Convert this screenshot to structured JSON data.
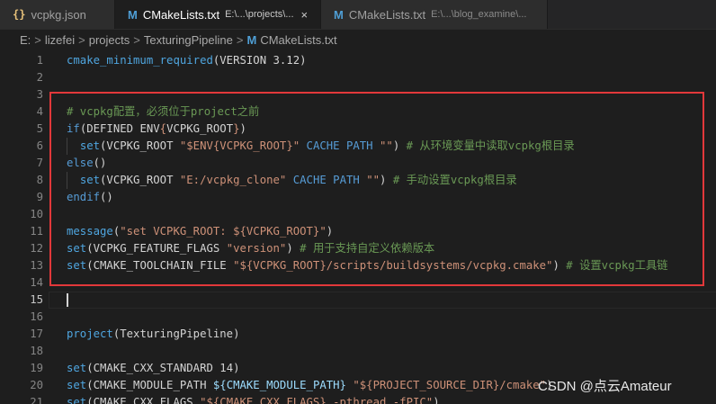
{
  "tabs": [
    {
      "icon": "{}",
      "label": "vcpkg.json",
      "description": "",
      "close": ""
    },
    {
      "icon": "M",
      "label": "CMakeLists.txt",
      "description": "E:\\...\\projects\\...",
      "close": "×"
    },
    {
      "icon": "M",
      "label": "CMakeLists.txt",
      "description": "E:\\...\\blog_examine\\...",
      "close": ""
    }
  ],
  "breadcrumb": {
    "items": [
      "E:",
      "lizefei",
      "projects",
      "TexturingPipeline"
    ],
    "separator": ">",
    "file_icon": "M",
    "file": "CMakeLists.txt"
  },
  "editor": {
    "lines": [
      {
        "n": "1",
        "segs": [
          [
            "fn",
            "cmake_minimum_required"
          ],
          [
            "p",
            "(VERSION 3.12)"
          ]
        ]
      },
      {
        "n": "2",
        "segs": []
      },
      {
        "n": "3",
        "segs": []
      },
      {
        "n": "4",
        "segs": [
          [
            "cm",
            "# vcpkg配置，必须位于project之前"
          ]
        ]
      },
      {
        "n": "5",
        "segs": [
          [
            "kw",
            "if"
          ],
          [
            "p",
            "(DEFINED ENV"
          ],
          [
            "str",
            "{"
          ],
          [
            "p",
            "VCPKG_ROOT"
          ],
          [
            "str",
            "}"
          ],
          [
            "p",
            ")"
          ]
        ]
      },
      {
        "n": "6",
        "segs": [
          [
            "p",
            "  "
          ],
          [
            "fn",
            "set"
          ],
          [
            "p",
            "(VCPKG_ROOT "
          ],
          [
            "str",
            "\"$ENV{VCPKG_ROOT}\""
          ],
          [
            "p",
            " "
          ],
          [
            "kw",
            "CACHE PATH"
          ],
          [
            "p",
            " "
          ],
          [
            "str",
            "\"\""
          ],
          [
            "p",
            ") "
          ],
          [
            "cm",
            "# 从环境变量中读取vcpkg根目录"
          ]
        ]
      },
      {
        "n": "7",
        "segs": [
          [
            "kw",
            "else"
          ],
          [
            "p",
            "()"
          ]
        ]
      },
      {
        "n": "8",
        "segs": [
          [
            "p",
            "  "
          ],
          [
            "fn",
            "set"
          ],
          [
            "p",
            "(VCPKG_ROOT "
          ],
          [
            "str",
            "\"E:/vcpkg_clone\""
          ],
          [
            "p",
            " "
          ],
          [
            "kw",
            "CACHE PATH"
          ],
          [
            "p",
            " "
          ],
          [
            "str",
            "\"\""
          ],
          [
            "p",
            ") "
          ],
          [
            "cm",
            "# 手动设置vcpkg根目录"
          ]
        ]
      },
      {
        "n": "9",
        "segs": [
          [
            "kw",
            "endif"
          ],
          [
            "p",
            "()"
          ]
        ]
      },
      {
        "n": "10",
        "segs": []
      },
      {
        "n": "11",
        "segs": [
          [
            "fn",
            "message"
          ],
          [
            "p",
            "("
          ],
          [
            "str",
            "\"set VCPKG_ROOT: ${VCPKG_ROOT}\""
          ],
          [
            "p",
            ")"
          ]
        ]
      },
      {
        "n": "12",
        "segs": [
          [
            "fn",
            "set"
          ],
          [
            "p",
            "(VCPKG_FEATURE_FLAGS "
          ],
          [
            "str",
            "\"version\""
          ],
          [
            "p",
            ") "
          ],
          [
            "cm",
            "# 用于支持自定义依赖版本"
          ]
        ]
      },
      {
        "n": "13",
        "segs": [
          [
            "fn",
            "set"
          ],
          [
            "p",
            "(CMAKE_TOOLCHAIN_FILE "
          ],
          [
            "str",
            "\"${VCPKG_ROOT}/scripts/buildsystems/vcpkg.cmake\""
          ],
          [
            "p",
            ") "
          ],
          [
            "cm",
            "# 设置vcpkg工具链"
          ]
        ]
      },
      {
        "n": "14",
        "segs": []
      },
      {
        "n": "15",
        "segs": [],
        "current": true
      },
      {
        "n": "16",
        "segs": []
      },
      {
        "n": "17",
        "segs": [
          [
            "fn",
            "project"
          ],
          [
            "p",
            "(TexturingPipeline)"
          ]
        ]
      },
      {
        "n": "18",
        "segs": []
      },
      {
        "n": "19",
        "segs": [
          [
            "fn",
            "set"
          ],
          [
            "p",
            "(CMAKE_CXX_STANDARD 14)"
          ]
        ]
      },
      {
        "n": "20",
        "segs": [
          [
            "fn",
            "set"
          ],
          [
            "p",
            "(CMAKE_MODULE_PATH "
          ],
          [
            "var",
            "${CMAKE_MODULE_PATH}"
          ],
          [
            "p",
            " "
          ],
          [
            "str",
            "\"${PROJECT_SOURCE_DIR}/cmake\""
          ],
          [
            "p",
            ")"
          ]
        ]
      },
      {
        "n": "21",
        "segs": [
          [
            "fn",
            "set"
          ],
          [
            "p",
            "(CMAKE_CXX_FLAGS "
          ],
          [
            "str",
            "\"${CMAKE_CXX_FLAGS} -pthread -fPIC\""
          ],
          [
            "p",
            ")"
          ]
        ]
      }
    ]
  },
  "watermark": "CSDN @点云Amateur",
  "colors": {
    "highlight_border": "#e2383a",
    "background": "#1e1e1e"
  }
}
